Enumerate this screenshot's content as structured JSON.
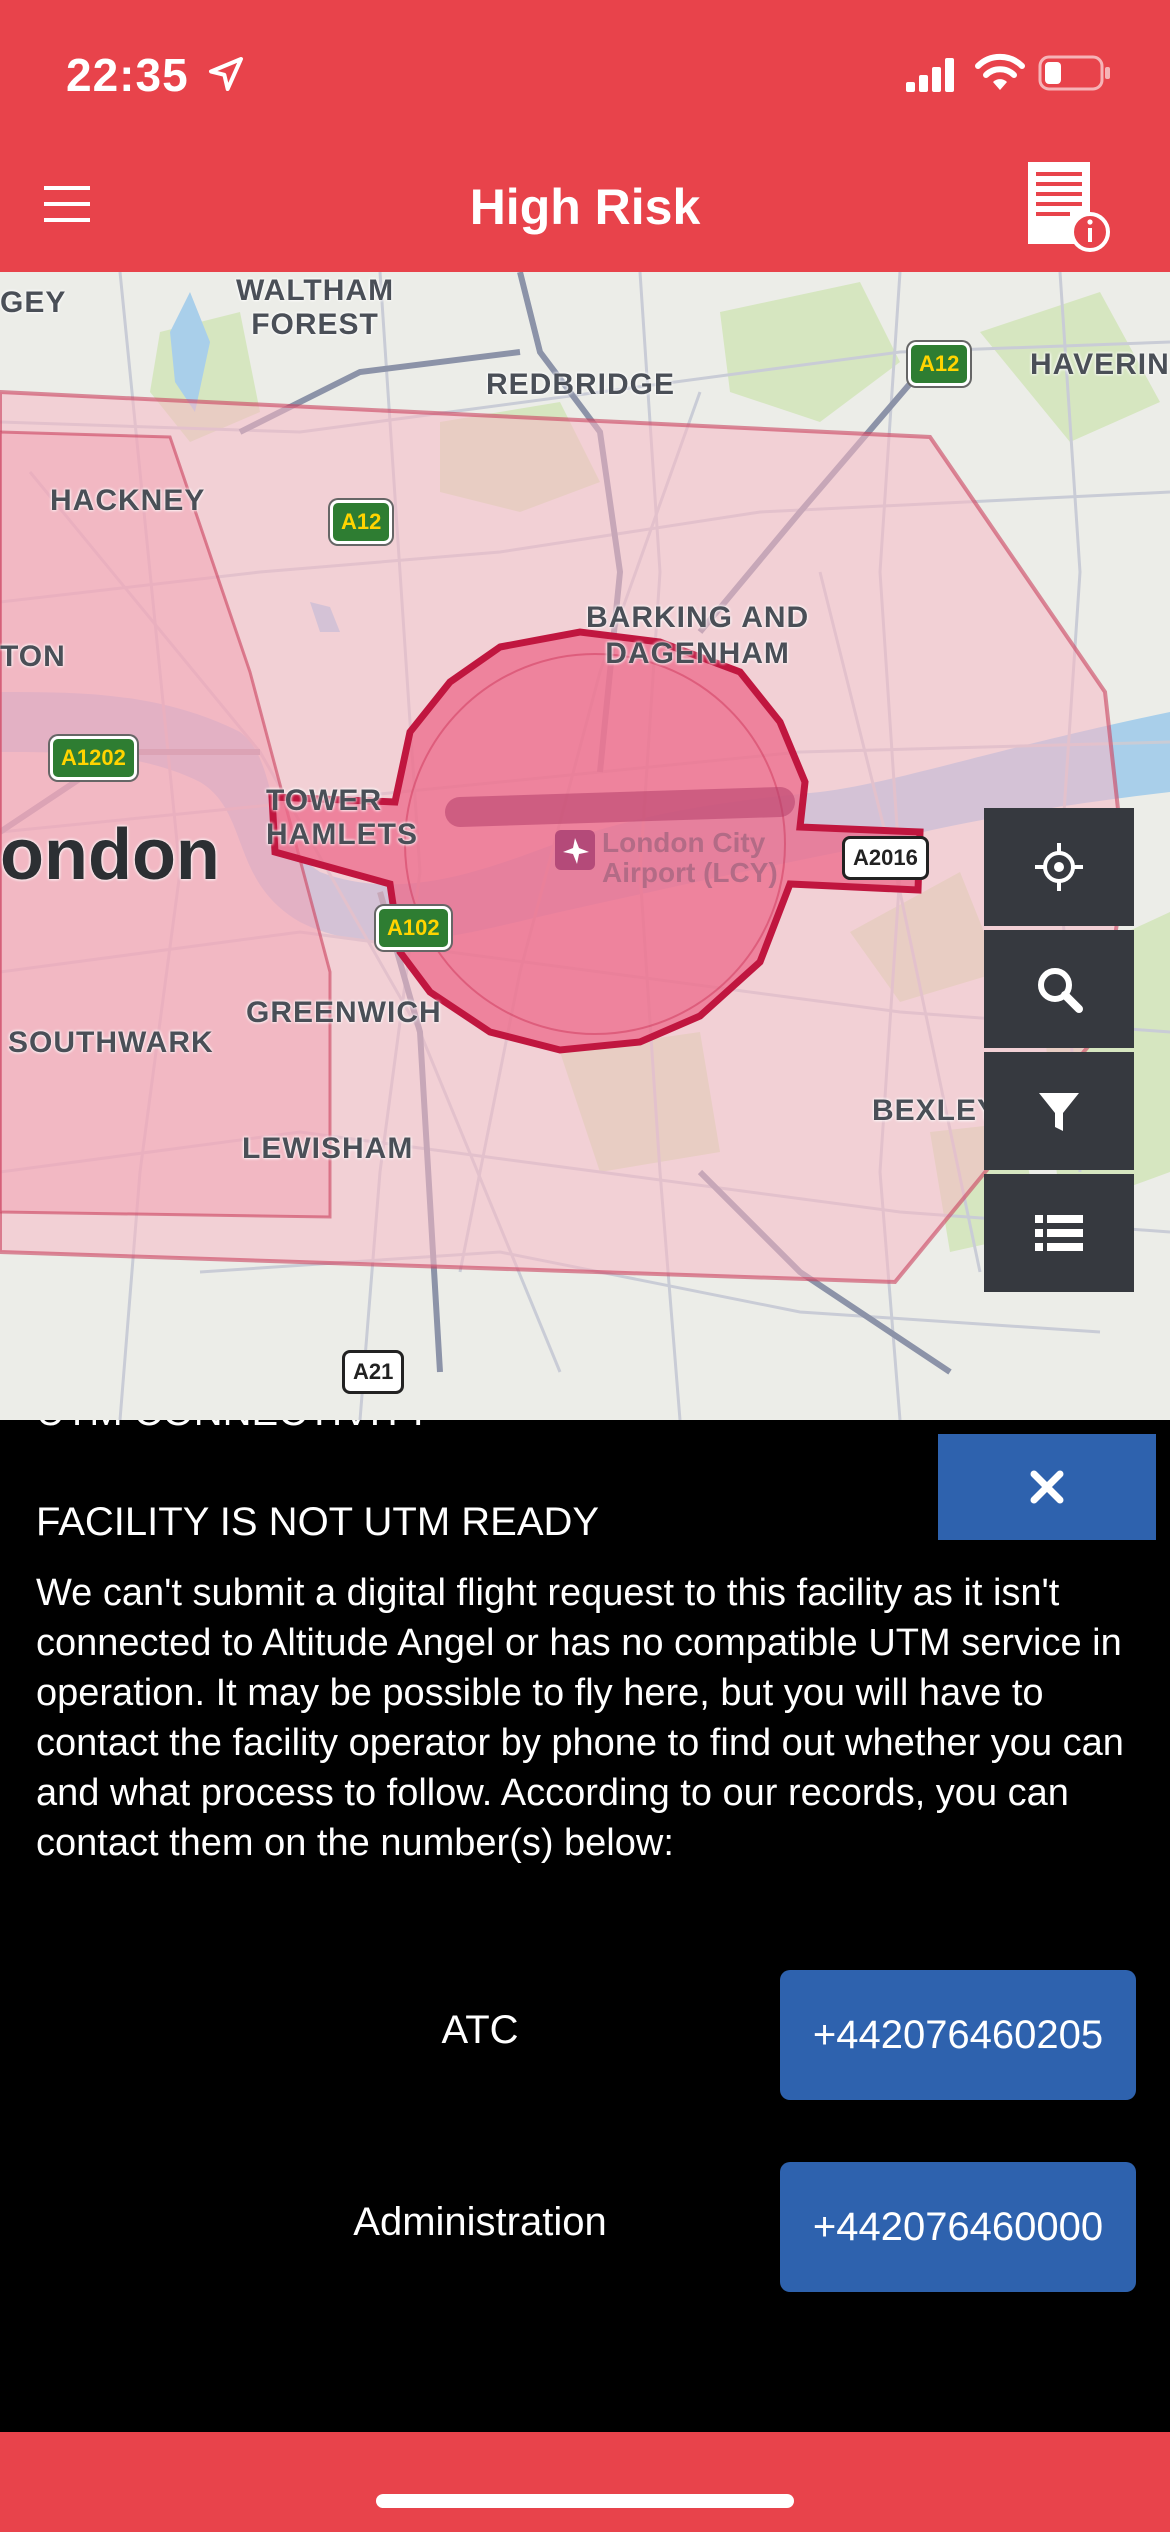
{
  "status_bar": {
    "time": "22:35"
  },
  "header": {
    "title": "High Risk"
  },
  "map": {
    "labels": {
      "waltham_forest": "WALTHAM\nFOREST",
      "redbridge": "REDBRIDGE",
      "havering": "HAVERING",
      "hackney": "HACKNEY",
      "barking": "BARKING AND\nDAGENHAM",
      "ton": "TON",
      "tower_hamlets": "TOWER\nHAMLETS",
      "london": "ondon",
      "greenwich": "GREENWICH",
      "southwark": "SOUTHWARK",
      "lewisham": "LEWISHAM",
      "bexley": "BEXLEY",
      "gey": "GEY",
      "airport": "London City\nAirport (LCY)"
    },
    "roads": {
      "a12_top": "A12",
      "a12_left": "A12",
      "a1202": "A1202",
      "a102": "A102",
      "a2016": "A2016",
      "a21": "A21"
    },
    "colors": {
      "zone_fill": "#F7B8C4",
      "zone_stroke": "#C9435F",
      "airport_fill": "#EC6A8A",
      "airport_stroke": "#C0163F"
    }
  },
  "tools": [
    "locate-icon",
    "search-icon",
    "filter-icon",
    "list-icon"
  ],
  "panel": {
    "section_title_cut": "UTM CONNECTIVITY",
    "heading": "FACILITY IS NOT UTM READY",
    "description": "We can't submit a digital flight request to this facility as it isn't connected to Altitude Angel or has no compatible UTM service in operation. It may be possible to fly here, but you will have to contact the facility operator by phone to find out whether you can and what process to follow. According to our records, you can contact them on the number(s) below:",
    "contacts": [
      {
        "label": "ATC",
        "phone": "+442076460205"
      },
      {
        "label": "Administration",
        "phone": "+442076460000"
      }
    ]
  },
  "colors": {
    "brand_red": "#E8434B",
    "button_blue": "#2E62AE",
    "tool_dark": "#36393F"
  }
}
